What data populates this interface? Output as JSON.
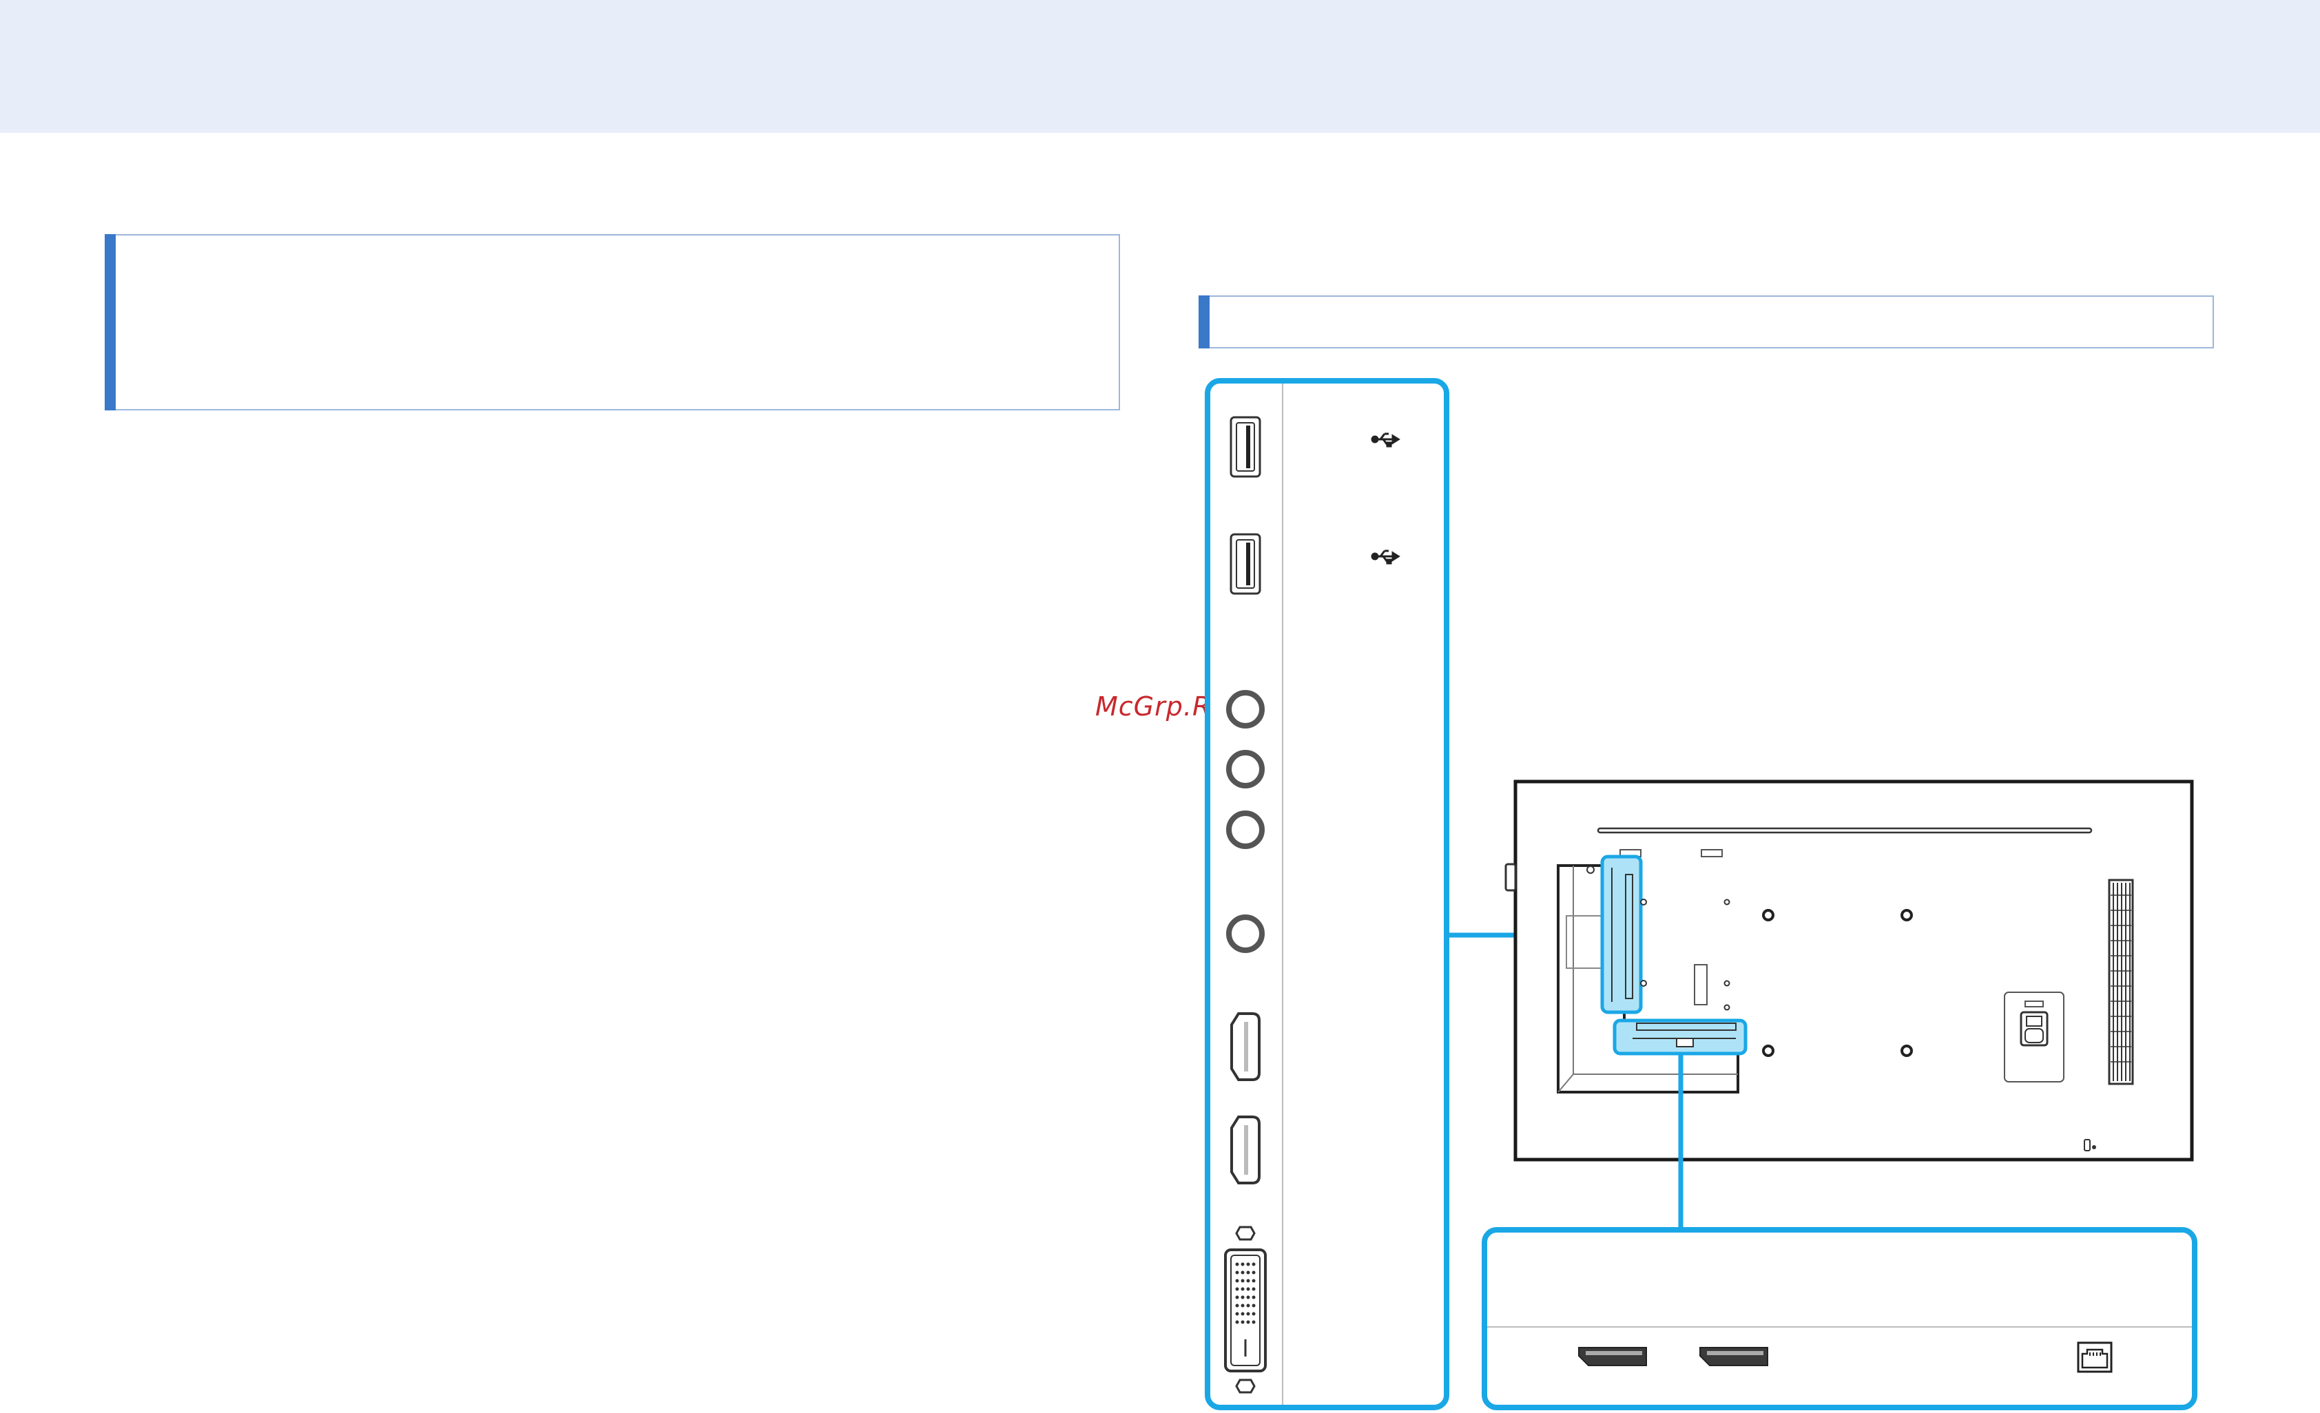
{
  "watermark": "McGrp.Ru",
  "colors": {
    "header_band": "#e8eef9",
    "accent_bar": "#3a78c9",
    "callout": "#1aa7e6",
    "callout_fill": "#aee3f7",
    "watermark": "#c8282d"
  },
  "icons": {
    "side_panel": [
      "usb-port-icon",
      "usb-port-icon",
      "audio-jack-icon",
      "audio-jack-icon",
      "audio-jack-icon",
      "audio-jack-icon",
      "hdmi-port-icon",
      "hdmi-port-icon",
      "dvi-port-icon"
    ],
    "side_labels": [
      "usb-symbol-icon",
      "usb-symbol-icon"
    ],
    "bottom_panel": [
      "displayport-icon",
      "displayport-icon",
      "rj45-port-icon"
    ]
  }
}
